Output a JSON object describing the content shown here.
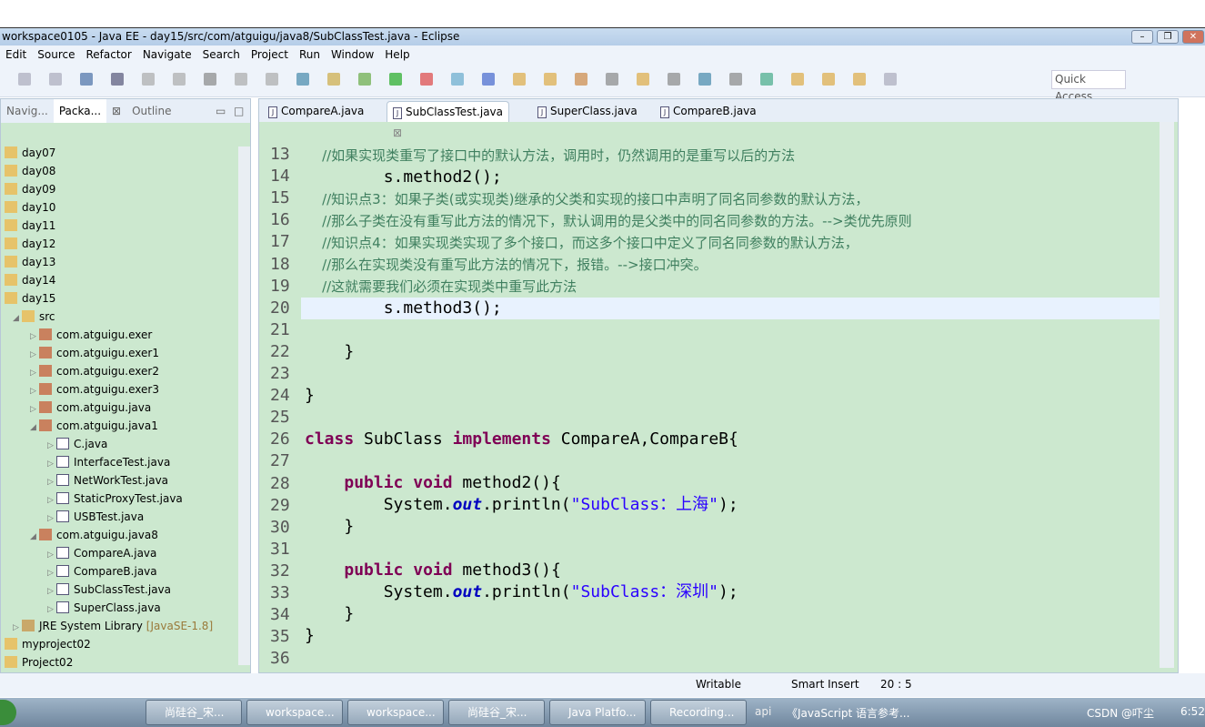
{
  "window": {
    "title": "workspace0105 - Java EE - day15/src/com/atguigu/java8/SubClassTest.java - Eclipse"
  },
  "menu": [
    "Edit",
    "Source",
    "Refactor",
    "Navigate",
    "Search",
    "Project",
    "Run",
    "Window",
    "Help"
  ],
  "toolbar": {
    "quick_access": "Quick Access"
  },
  "left_panel": {
    "tabs": [
      "Navig...",
      "Packa...",
      "Outline"
    ],
    "tree": [
      {
        "label": "day07",
        "depth": 0,
        "type": "project"
      },
      {
        "label": "day08",
        "depth": 0,
        "type": "project"
      },
      {
        "label": "day09",
        "depth": 0,
        "type": "project"
      },
      {
        "label": "day10",
        "depth": 0,
        "type": "project"
      },
      {
        "label": "day11",
        "depth": 0,
        "type": "project"
      },
      {
        "label": "day12",
        "depth": 0,
        "type": "project"
      },
      {
        "label": "day13",
        "depth": 0,
        "type": "project"
      },
      {
        "label": "day14",
        "depth": 0,
        "type": "project"
      },
      {
        "label": "day15",
        "depth": 0,
        "type": "project"
      },
      {
        "label": "src",
        "depth": 1,
        "type": "folder",
        "open": true
      },
      {
        "label": "com.atguigu.exer",
        "depth": 2,
        "type": "package"
      },
      {
        "label": "com.atguigu.exer1",
        "depth": 2,
        "type": "package"
      },
      {
        "label": "com.atguigu.exer2",
        "depth": 2,
        "type": "package"
      },
      {
        "label": "com.atguigu.exer3",
        "depth": 2,
        "type": "package"
      },
      {
        "label": "com.atguigu.java",
        "depth": 2,
        "type": "package"
      },
      {
        "label": "com.atguigu.java1",
        "depth": 2,
        "type": "package",
        "open": true
      },
      {
        "label": "C.java",
        "depth": 3,
        "type": "file"
      },
      {
        "label": "InterfaceTest.java",
        "depth": 3,
        "type": "file"
      },
      {
        "label": "NetWorkTest.java",
        "depth": 3,
        "type": "file"
      },
      {
        "label": "StaticProxyTest.java",
        "depth": 3,
        "type": "file"
      },
      {
        "label": "USBTest.java",
        "depth": 3,
        "type": "file"
      },
      {
        "label": "com.atguigu.java8",
        "depth": 2,
        "type": "package",
        "open": true
      },
      {
        "label": "CompareA.java",
        "depth": 3,
        "type": "file"
      },
      {
        "label": "CompareB.java",
        "depth": 3,
        "type": "file"
      },
      {
        "label": "SubClassTest.java",
        "depth": 3,
        "type": "file"
      },
      {
        "label": "SuperClass.java",
        "depth": 3,
        "type": "file"
      },
      {
        "label": "JRE System Library",
        "extra": "[JavaSE-1.8]",
        "depth": 1,
        "type": "library"
      },
      {
        "label": "myproject02",
        "depth": 0,
        "type": "project"
      },
      {
        "label": "Project02",
        "depth": 0,
        "type": "project"
      }
    ]
  },
  "editor": {
    "tabs": [
      {
        "label": "CompareA.java"
      },
      {
        "label": "SubClassTest.java",
        "active": true
      },
      {
        "label": "SuperClass.java"
      },
      {
        "label": "CompareB.java"
      }
    ],
    "lines": [
      {
        "n": "13",
        "t": [
          [
            "cm",
            "    //如果实现类重写了接口中的默认方法，调用时，仍然调用的是重写以后的方法"
          ]
        ]
      },
      {
        "n": "14",
        "t": [
          [
            "",
            "        s.method2();"
          ]
        ]
      },
      {
        "n": "15",
        "t": [
          [
            "cm",
            "    //知识点3：如果子类(或实现类)继承的父类和实现的接口中声明了同名同参数的默认方法，"
          ]
        ]
      },
      {
        "n": "16",
        "t": [
          [
            "cm",
            "    //那么子类在没有重写此方法的情况下，默认调用的是父类中的同名同参数的方法。-->类优先原则"
          ]
        ]
      },
      {
        "n": "17",
        "t": [
          [
            "cm",
            "    //知识点4：如果实现类实现了多个接口，而这多个接口中定义了同名同参数的默认方法，"
          ]
        ]
      },
      {
        "n": "18",
        "t": [
          [
            "cm",
            "    //那么在实现类没有重写此方法的情况下，报错。-->接口冲突。"
          ]
        ]
      },
      {
        "n": "19",
        "t": [
          [
            "cm",
            "    //这就需要我们必须在实现类中重写此方法"
          ]
        ]
      },
      {
        "n": "20",
        "t": [
          [
            "",
            "        s.method3();"
          ]
        ]
      },
      {
        "n": "21",
        "t": []
      },
      {
        "n": "22",
        "t": [
          [
            "",
            "    }"
          ]
        ]
      },
      {
        "n": "23",
        "t": []
      },
      {
        "n": "24",
        "t": [
          [
            "",
            "}"
          ]
        ]
      },
      {
        "n": "25",
        "t": []
      },
      {
        "n": "26",
        "t": [
          [
            "kw",
            "class"
          ],
          [
            "",
            " SubClass "
          ],
          [
            "kw",
            "implements"
          ],
          [
            "",
            " CompareA,CompareB{"
          ]
        ]
      },
      {
        "n": "27",
        "t": []
      },
      {
        "n": "28",
        "t": [
          [
            "",
            "    "
          ],
          [
            "kw",
            "public"
          ],
          [
            "",
            " "
          ],
          [
            "kw",
            "void"
          ],
          [
            "",
            " method2(){"
          ]
        ]
      },
      {
        "n": "29",
        "t": [
          [
            "",
            "        System."
          ],
          [
            "fd",
            "out"
          ],
          [
            "",
            ".println("
          ],
          [
            "st",
            "\"SubClass：上海\""
          ],
          [
            "",
            ");"
          ]
        ]
      },
      {
        "n": "30",
        "t": [
          [
            "",
            "    }"
          ]
        ]
      },
      {
        "n": "31",
        "t": []
      },
      {
        "n": "32",
        "t": [
          [
            "",
            "    "
          ],
          [
            "kw",
            "public"
          ],
          [
            "",
            " "
          ],
          [
            "kw",
            "void"
          ],
          [
            "",
            " method3(){"
          ]
        ]
      },
      {
        "n": "33",
        "t": [
          [
            "",
            "        System."
          ],
          [
            "fd",
            "out"
          ],
          [
            "",
            ".println("
          ],
          [
            "st",
            "\"SubClass：深圳\""
          ],
          [
            "",
            ");"
          ]
        ]
      },
      {
        "n": "34",
        "t": [
          [
            "",
            "    }"
          ]
        ]
      },
      {
        "n": "35",
        "t": [
          [
            "",
            "}"
          ]
        ]
      },
      {
        "n": "36",
        "t": []
      }
    ]
  },
  "status": {
    "writable": "Writable",
    "insert_mode": "Smart Insert",
    "position": "20 : 5"
  },
  "taskbar": {
    "items": [
      "尚硅谷_宋...",
      "workspace...",
      "workspace...",
      "尚硅谷_宋...",
      "Java Platfo...",
      "Recording..."
    ],
    "extra_label": "api",
    "extra_item": "《JavaScript 语言参考...",
    "tray_text": "CSDN @吓尘",
    "clock": "6:52"
  }
}
